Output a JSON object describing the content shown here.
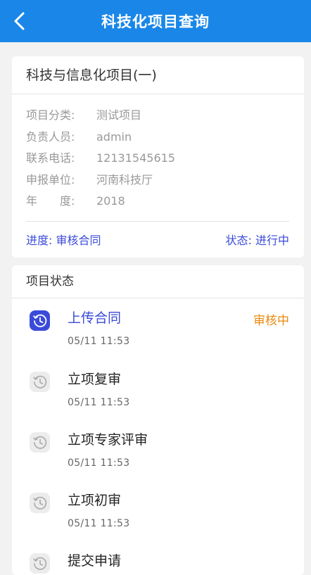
{
  "header": {
    "title": "科技化项目查询"
  },
  "project": {
    "title": "科技与信息化项目(一)",
    "fields": [
      {
        "label": "项目分类:",
        "value": "测试项目"
      },
      {
        "label": "负责人员:",
        "value": "admin"
      },
      {
        "label": "联系电话:",
        "value": "12131545615"
      },
      {
        "label": "申报单位:",
        "value": "河南科技厅"
      },
      {
        "label": "年　　度:",
        "value": "2018"
      }
    ],
    "progress": "进度: 审核合同",
    "status": "状态: 进行中"
  },
  "status_section": {
    "title": "项目状态",
    "steps": [
      {
        "name": "上传合同",
        "time": "05/11  11:53",
        "badge": "审核中",
        "active": true
      },
      {
        "name": "立项复审",
        "time": "05/11  11:53"
      },
      {
        "name": "立项专家评审",
        "time": "05/11  11:53"
      },
      {
        "name": "立项初审",
        "time": "05/11  11:53"
      },
      {
        "name": "提交申请",
        "time": ""
      }
    ]
  },
  "colors": {
    "header": "#1a87e8",
    "accent": "#3a4ad9",
    "badge": "#e88a0c"
  },
  "icons": {
    "back": "chevron-left-icon",
    "step": "history-clock-icon"
  }
}
